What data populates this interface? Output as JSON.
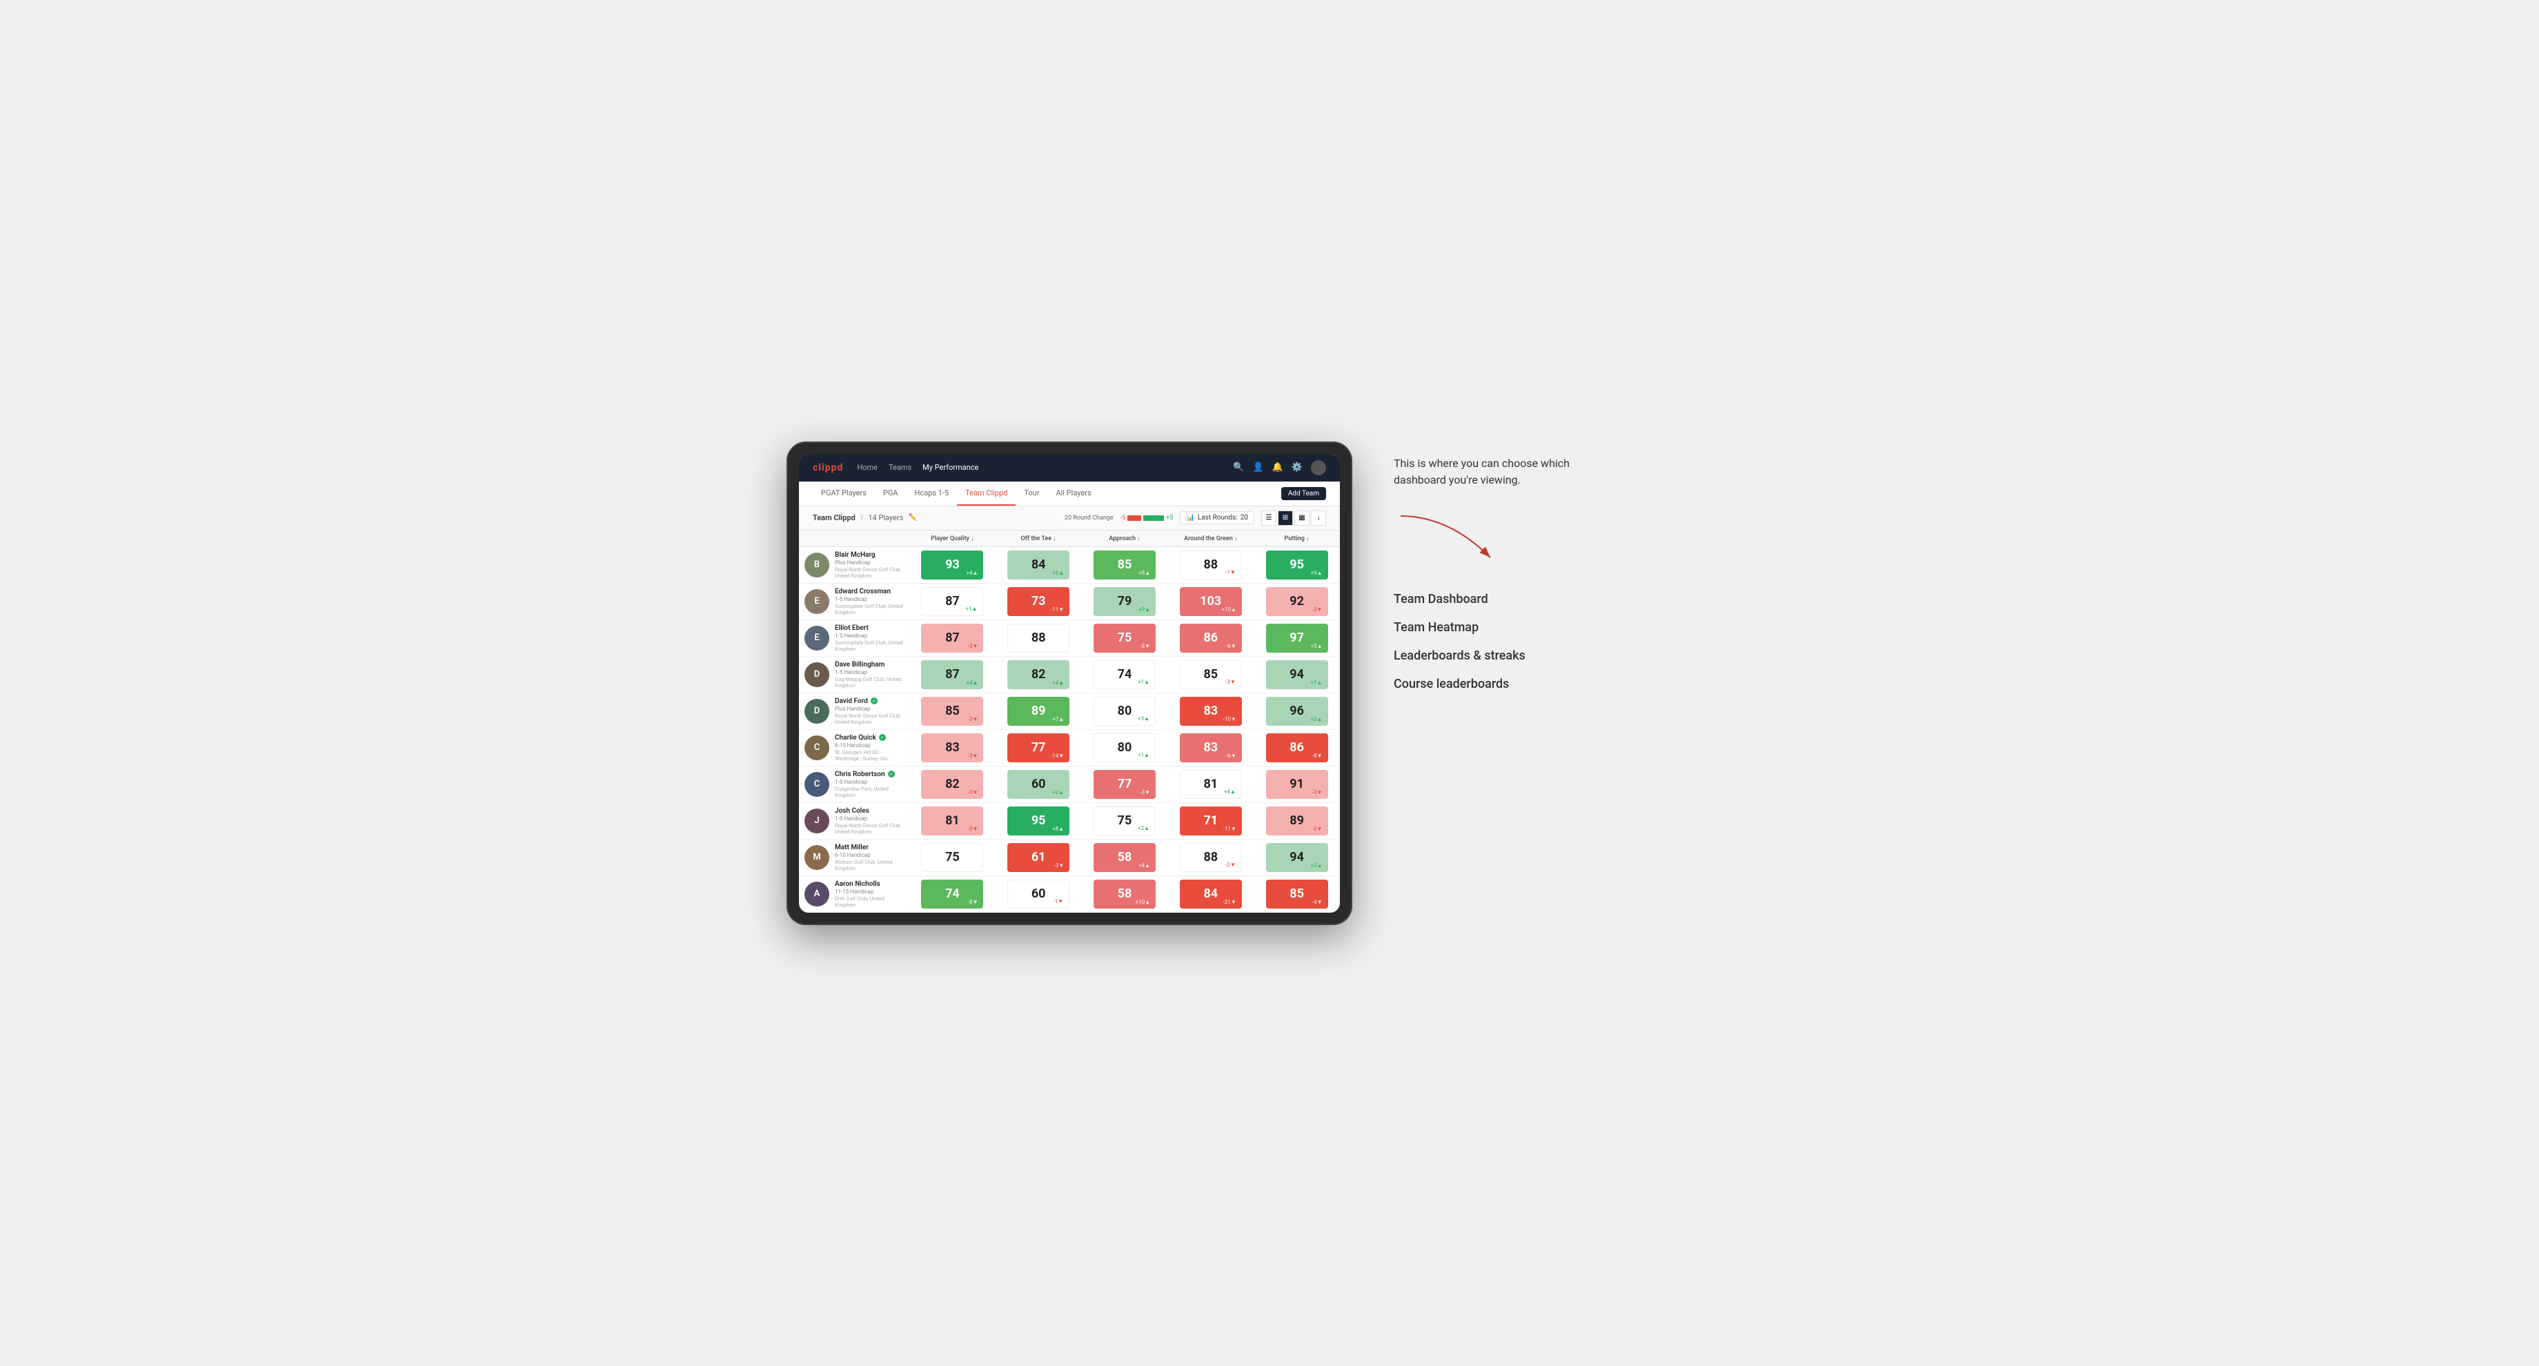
{
  "annotation": {
    "description": "This is where you can choose which dashboard you're viewing.",
    "options": [
      "Team Dashboard",
      "Team Heatmap",
      "Leaderboards & streaks",
      "Course leaderboards"
    ]
  },
  "nav": {
    "logo": "clippd",
    "links": [
      "Home",
      "Teams",
      "My Performance"
    ],
    "active_link": "My Performance"
  },
  "sub_nav": {
    "links": [
      "PGAT Players",
      "PGA",
      "Hcaps 1-5",
      "Team Clippd",
      "Tour",
      "All Players"
    ],
    "active_link": "Team Clippd",
    "add_button": "Add Team"
  },
  "team_header": {
    "title": "Team Clippd",
    "player_count": "14 Players",
    "round_change_label": "20 Round Change",
    "round_change_negative": "-5",
    "round_change_positive": "+5",
    "last_rounds_label": "Last Rounds:",
    "last_rounds_value": "20"
  },
  "table": {
    "columns": [
      "Player Quality ↓",
      "Off the Tee ↓",
      "Approach ↓",
      "Around the Green ↓",
      "Putting ↓"
    ],
    "rows": [
      {
        "name": "Blair McHarg",
        "handicap": "Plus Handicap",
        "club": "Royal North Devon Golf Club, United Kingdom",
        "verified": false,
        "avatar_color": "#7a8a6a",
        "stats": [
          {
            "value": 93,
            "change": "+4",
            "direction": "up",
            "bg": "green-strong"
          },
          {
            "value": 84,
            "change": "+6",
            "direction": "up",
            "bg": "green-light"
          },
          {
            "value": 85,
            "change": "+8",
            "direction": "up",
            "bg": "green-medium"
          },
          {
            "value": 88,
            "change": "-1",
            "direction": "down",
            "bg": "white"
          },
          {
            "value": 95,
            "change": "+9",
            "direction": "up",
            "bg": "green-strong"
          }
        ]
      },
      {
        "name": "Edward Crossman",
        "handicap": "1-5 Handicap",
        "club": "Sunningdale Golf Club, United Kingdom",
        "verified": false,
        "avatar_color": "#8a7a6a",
        "stats": [
          {
            "value": 87,
            "change": "+1",
            "direction": "up",
            "bg": "white"
          },
          {
            "value": 73,
            "change": "-11",
            "direction": "down",
            "bg": "red-strong"
          },
          {
            "value": 79,
            "change": "+9",
            "direction": "up",
            "bg": "green-light"
          },
          {
            "value": 103,
            "change": "+15",
            "direction": "up",
            "bg": "red-medium"
          },
          {
            "value": 92,
            "change": "-3",
            "direction": "down",
            "bg": "red-light"
          }
        ]
      },
      {
        "name": "Elliot Ebert",
        "handicap": "1-5 Handicap",
        "club": "Sunningdale Golf Club, United Kingdom",
        "verified": false,
        "avatar_color": "#5a6a7a",
        "stats": [
          {
            "value": 87,
            "change": "-3",
            "direction": "down",
            "bg": "red-light"
          },
          {
            "value": 88,
            "change": "",
            "direction": "",
            "bg": "white"
          },
          {
            "value": 75,
            "change": "-3",
            "direction": "down",
            "bg": "red-medium"
          },
          {
            "value": 86,
            "change": "-6",
            "direction": "down",
            "bg": "red-medium"
          },
          {
            "value": 97,
            "change": "+5",
            "direction": "up",
            "bg": "green-medium"
          }
        ]
      },
      {
        "name": "Dave Billingham",
        "handicap": "1-5 Handicap",
        "club": "Gog Magog Golf Club, United Kingdom",
        "verified": false,
        "avatar_color": "#6a5a4a",
        "stats": [
          {
            "value": 87,
            "change": "+4",
            "direction": "up",
            "bg": "green-light"
          },
          {
            "value": 82,
            "change": "+4",
            "direction": "up",
            "bg": "green-light"
          },
          {
            "value": 74,
            "change": "+1",
            "direction": "up",
            "bg": "white"
          },
          {
            "value": 85,
            "change": "-3",
            "direction": "down",
            "bg": "white"
          },
          {
            "value": 94,
            "change": "+1",
            "direction": "up",
            "bg": "green-light"
          }
        ]
      },
      {
        "name": "David Ford",
        "handicap": "Plus Handicap",
        "club": "Royal North Devon Golf Club, United Kingdom",
        "verified": true,
        "avatar_color": "#4a6a5a",
        "stats": [
          {
            "value": 85,
            "change": "-3",
            "direction": "down",
            "bg": "red-light"
          },
          {
            "value": 89,
            "change": "+7",
            "direction": "up",
            "bg": "green-medium"
          },
          {
            "value": 80,
            "change": "+3",
            "direction": "up",
            "bg": "white"
          },
          {
            "value": 83,
            "change": "-10",
            "direction": "down",
            "bg": "red-strong"
          },
          {
            "value": 96,
            "change": "+3",
            "direction": "up",
            "bg": "green-light"
          }
        ]
      },
      {
        "name": "Charlie Quick",
        "handicap": "6-10 Handicap",
        "club": "St. George's Hill GC - Weybridge - Surrey, Uni...",
        "verified": true,
        "avatar_color": "#7a6a4a",
        "stats": [
          {
            "value": 83,
            "change": "-3",
            "direction": "down",
            "bg": "red-light"
          },
          {
            "value": 77,
            "change": "-14",
            "direction": "down",
            "bg": "red-strong"
          },
          {
            "value": 80,
            "change": "+1",
            "direction": "up",
            "bg": "white"
          },
          {
            "value": 83,
            "change": "-6",
            "direction": "down",
            "bg": "red-medium"
          },
          {
            "value": 86,
            "change": "-8",
            "direction": "down",
            "bg": "red-strong"
          }
        ]
      },
      {
        "name": "Chris Robertson",
        "handicap": "1-5 Handicap",
        "club": "Craigmillar Park, United Kingdom",
        "verified": true,
        "avatar_color": "#4a5a7a",
        "stats": [
          {
            "value": 82,
            "change": "-3",
            "direction": "down",
            "bg": "red-light"
          },
          {
            "value": 60,
            "change": "+2",
            "direction": "up",
            "bg": "green-light"
          },
          {
            "value": 77,
            "change": "-3",
            "direction": "down",
            "bg": "red-medium"
          },
          {
            "value": 81,
            "change": "+4",
            "direction": "up",
            "bg": "white"
          },
          {
            "value": 91,
            "change": "-3",
            "direction": "down",
            "bg": "red-light"
          }
        ]
      },
      {
        "name": "Josh Coles",
        "handicap": "1-5 Handicap",
        "club": "Royal North Devon Golf Club, United Kingdom",
        "verified": false,
        "avatar_color": "#6a4a5a",
        "stats": [
          {
            "value": 81,
            "change": "-3",
            "direction": "down",
            "bg": "red-light"
          },
          {
            "value": 95,
            "change": "+8",
            "direction": "up",
            "bg": "green-strong"
          },
          {
            "value": 75,
            "change": "+2",
            "direction": "up",
            "bg": "white"
          },
          {
            "value": 71,
            "change": "-11",
            "direction": "down",
            "bg": "red-strong"
          },
          {
            "value": 89,
            "change": "-2",
            "direction": "down",
            "bg": "red-light"
          }
        ]
      },
      {
        "name": "Matt Miller",
        "handicap": "6-10 Handicap",
        "club": "Woburn Golf Club, United Kingdom",
        "verified": false,
        "avatar_color": "#8a6a4a",
        "stats": [
          {
            "value": 75,
            "change": "",
            "direction": "",
            "bg": "white"
          },
          {
            "value": 61,
            "change": "-3",
            "direction": "down",
            "bg": "red-strong"
          },
          {
            "value": 58,
            "change": "+4",
            "direction": "up",
            "bg": "red-medium"
          },
          {
            "value": 88,
            "change": "-2",
            "direction": "down",
            "bg": "white"
          },
          {
            "value": 94,
            "change": "+3",
            "direction": "up",
            "bg": "green-light"
          }
        ]
      },
      {
        "name": "Aaron Nicholls",
        "handicap": "11-15 Handicap",
        "club": "Drift Golf Club, United Kingdom",
        "verified": false,
        "avatar_color": "#5a4a6a",
        "stats": [
          {
            "value": 74,
            "change": "-8",
            "direction": "down",
            "bg": "green-medium"
          },
          {
            "value": 60,
            "change": "-1",
            "direction": "down",
            "bg": "white"
          },
          {
            "value": 58,
            "change": "+10",
            "direction": "up",
            "bg": "red-medium"
          },
          {
            "value": 84,
            "change": "-21",
            "direction": "down",
            "bg": "red-strong"
          },
          {
            "value": 85,
            "change": "-4",
            "direction": "down",
            "bg": "red-strong"
          }
        ]
      }
    ]
  }
}
